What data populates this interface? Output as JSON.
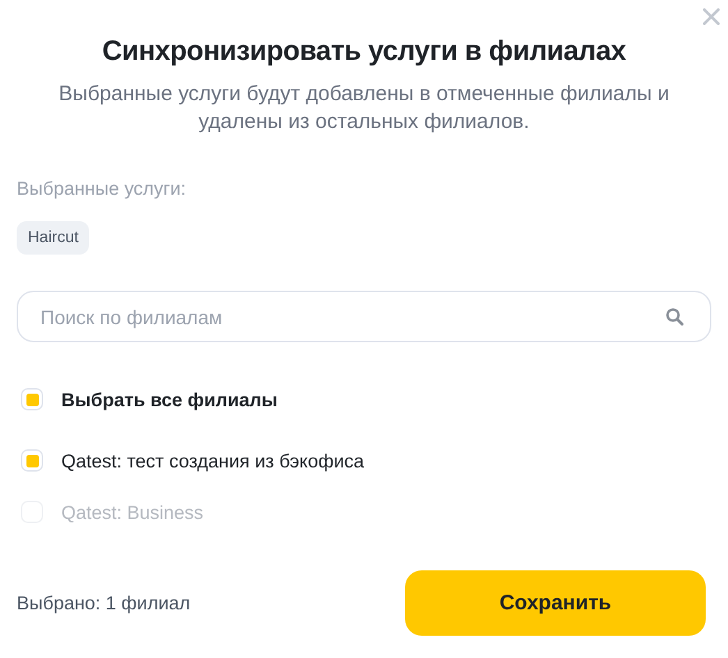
{
  "dialog": {
    "title": "Синхронизировать услуги в филиалах",
    "description": "Выбранные услуги будут добавлены в отмеченные филиалы и удалены из остальных филиалов."
  },
  "selected_services": {
    "label": "Выбранные услуги:",
    "chips": [
      "Haircut"
    ]
  },
  "search": {
    "placeholder": "Поиск по филиалам"
  },
  "select_all": {
    "label": "Выбрать все филиалы",
    "checked": true
  },
  "branches": [
    {
      "name": "Qatest: тест создания из бэкофиса",
      "checked": true,
      "disabled": false
    },
    {
      "name": "Qatest: Business",
      "checked": false,
      "disabled": true
    }
  ],
  "footer": {
    "count": "Выбрано: 1 филиал",
    "button": "Сохранить"
  }
}
